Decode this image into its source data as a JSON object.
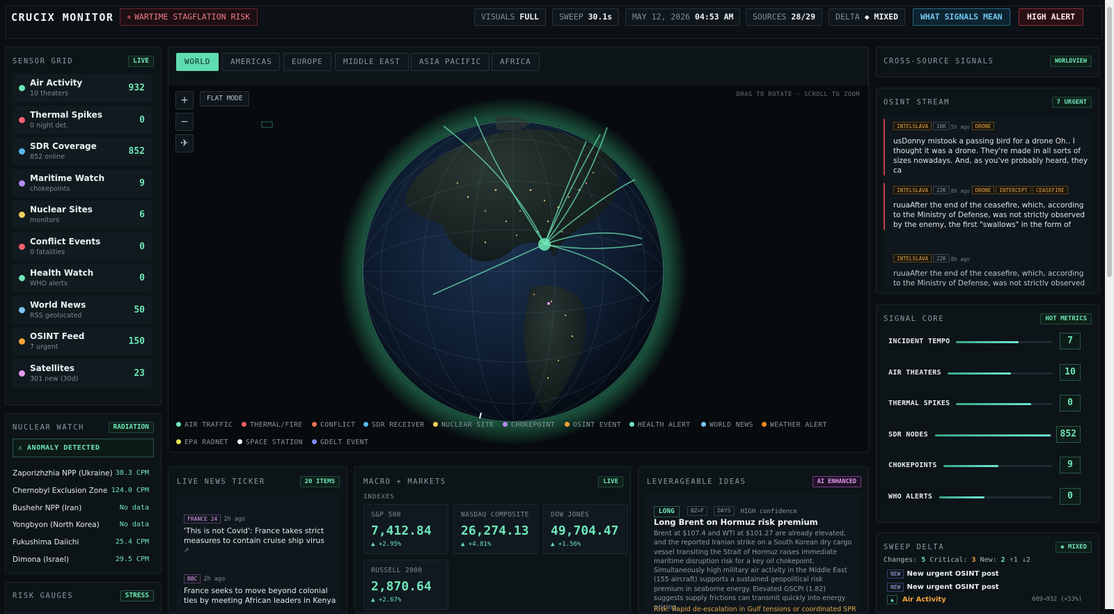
{
  "header": {
    "brand": "CRUCIX MONITOR",
    "risk_label": "WARTIME STAGFLATION RISK",
    "visuals_label": "VISUALS",
    "visuals_value": "FULL",
    "sweep_label": "SWEEP",
    "sweep_value": "30.1s",
    "date_label": "MAY 12, 2026",
    "time_value": "04:53 AM",
    "sources_label": "SOURCES",
    "sources_value": "28/29",
    "delta_label": "DELTA",
    "delta_value": "◆ MIXED",
    "signals_button": "WHAT SIGNALS MEAN",
    "alert_button": "HIGH ALERT"
  },
  "sensor_grid": {
    "title": "SENSOR GRID",
    "badge": "LIVE",
    "items": [
      {
        "name": "Air Activity",
        "sub": "10 theaters",
        "value": "932",
        "color": "#6ee7b7"
      },
      {
        "name": "Thermal Spikes",
        "sub": "0 night det.",
        "value": "0",
        "color": "#f4606a"
      },
      {
        "name": "SDR Coverage",
        "sub": "852 online",
        "value": "852",
        "color": "#5ab8f0"
      },
      {
        "name": "Maritime Watch",
        "sub": "chokepoints",
        "value": "9",
        "color": "#b78af2"
      },
      {
        "name": "Nuclear Sites",
        "sub": "monitors",
        "value": "6",
        "color": "#f2d35a"
      },
      {
        "name": "Conflict Events",
        "sub": "0 fatalities",
        "value": "0",
        "color": "#f4606a"
      },
      {
        "name": "Health Watch",
        "sub": "WHO alerts",
        "value": "0",
        "color": "#6ee7b7"
      },
      {
        "name": "World News",
        "sub": "RSS geolocated",
        "value": "50",
        "color": "#7ec4f2"
      },
      {
        "name": "OSINT Feed",
        "sub": "7 urgent",
        "value": "150",
        "color": "#f6a33a"
      },
      {
        "name": "Satellites",
        "sub": "301 new (30d)",
        "value": "23",
        "color": "#e39af0"
      }
    ]
  },
  "nuclear": {
    "title": "NUCLEAR WATCH",
    "badge": "RADIATION",
    "anomaly": "⚠ ANOMALY DETECTED",
    "rows": [
      {
        "site": "Zaporizhzhia NPP (Ukraine)",
        "value": "38.3 CPM"
      },
      {
        "site": "Chernobyl Exclusion Zone",
        "value": "124.0 CPM"
      },
      {
        "site": "Bushehr NPP (Iran)",
        "value": "No data"
      },
      {
        "site": "Yongbyon (North Korea)",
        "value": "No data"
      },
      {
        "site": "Fukushima Daiichi",
        "value": "25.4 CPM"
      },
      {
        "site": "Dimona (Israel)",
        "value": "29.5 CPM"
      }
    ]
  },
  "risk_gauges": {
    "title": "RISK GAUGES",
    "badge": "STRESS"
  },
  "regions": [
    "WORLD",
    "AMERICAS",
    "EUROPE",
    "MIDDLE EAST",
    "ASIA PACIFIC",
    "AFRICA"
  ],
  "map": {
    "flat_mode": "FLAT MODE",
    "hint": "DRAG TO ROTATE · SCROLL TO ZOOM",
    "zoom_in": "+",
    "zoom_out": "−",
    "plane": "✈",
    "legend": [
      {
        "label": "AIR TRAFFIC",
        "color": "#6ee7b7"
      },
      {
        "label": "THERMAL/FIRE",
        "color": "#f4606a"
      },
      {
        "label": "CONFLICT",
        "color": "#e8734a"
      },
      {
        "label": "SDR RECEIVER",
        "color": "#5ab8f0"
      },
      {
        "label": "NUCLEAR SITE",
        "color": "#f2d35a"
      },
      {
        "label": "CHOKEPOINT",
        "color": "#b78af2"
      },
      {
        "label": "OSINT EVENT",
        "color": "#f6a33a"
      },
      {
        "label": "HEALTH ALERT",
        "color": "#6ee7b7"
      },
      {
        "label": "WORLD NEWS",
        "color": "#7ec4f2"
      },
      {
        "label": "WEATHER ALERT",
        "color": "#f6891f"
      },
      {
        "label": "EPA RADNET",
        "color": "#e3e35a"
      },
      {
        "label": "SPACE STATION",
        "color": "#ffffff"
      },
      {
        "label": "GDELT EVENT",
        "color": "#7f8ef0"
      }
    ]
  },
  "cross_source": {
    "title": "CROSS-SOURCE SIGNALS",
    "badge": "WORLDVIEW"
  },
  "osint": {
    "title": "OSINT STREAM",
    "badge": "7 URGENT",
    "posts": [
      {
        "source": "INTELSLAVA",
        "views": "16K",
        "age": "5h ago",
        "tags": [
          "DRONE"
        ],
        "text": "usDonny mistook a passing bird for a drone Oh.. I thought it was a drone. They're made in all sorts of sizes nowadays. And, as you've probably heard, they ca"
      },
      {
        "source": "INTELSLAVA",
        "views": "22K",
        "age": "8h ago",
        "tags": [
          "DRONE",
          "INTERCEPT",
          "CEASEFIRE"
        ],
        "text": "ruuaAfter the end of the ceasefire, which, according to the Ministry of Defense, was not strictly observed by the enemy, the first \"swallows\" in the form of"
      },
      {
        "source": "INTELSLAVA",
        "views": "22K",
        "age": "8h ago",
        "tags": [],
        "text": "ruuaAfter the end of the ceasefire, which, according to the Ministry of Defense, was not strictly observed by"
      }
    ]
  },
  "signal_core": {
    "title": "SIGNAL CORE",
    "badge": "HOT METRICS",
    "metrics": [
      {
        "label": "INCIDENT TEMPO",
        "value": "7",
        "level": 0.65
      },
      {
        "label": "AIR THEATERS",
        "value": "10",
        "level": 0.6
      },
      {
        "label": "THERMAL SPIKES",
        "value": "0",
        "level": 0.78
      },
      {
        "label": "SDR NODES",
        "value": "852",
        "level": 0.98
      },
      {
        "label": "CHOKEPOINTS",
        "value": "9",
        "level": 0.5
      },
      {
        "label": "WHO ALERTS",
        "value": "0",
        "level": 0.4
      }
    ]
  },
  "sweep_delta": {
    "title": "SWEEP DELTA",
    "badge": "◆ MIXED",
    "changes_label": "Changes:",
    "changes": "5",
    "critical_label": "Critical:",
    "critical": "3",
    "new_label": "New:",
    "new": "2",
    "up": "↑1",
    "down": "↓2",
    "rows": [
      {
        "tag": "NEW",
        "text": "New urgent OSINT post"
      },
      {
        "tag": "NEW",
        "text": "New urgent OSINT post"
      }
    ],
    "air_tag": "▲",
    "air_label": "Air Activity",
    "air_value": "609→932 (+53%)"
  },
  "news_ticker": {
    "title": "LIVE NEWS TICKER",
    "badge": "20 ITEMS",
    "items": [
      {
        "source": "FRANCE 24",
        "age": "2h ago",
        "headline": "'This is not Covid': France takes strict measures to contain cruise ship virus",
        "arrow": "↗"
      },
      {
        "source": "BBC",
        "age": "2h ago",
        "headline": "France seeks to move beyond colonial ties by meeting African leaders in Kenya"
      }
    ]
  },
  "markets": {
    "title": "MACRO + MARKETS",
    "badge": "LIVE",
    "section": "INDEXES",
    "indexes": [
      {
        "label": "S&P 500",
        "value": "7,412.84",
        "change": "▲ +2.95%"
      },
      {
        "label": "NASDAQ COMPOSITE",
        "value": "26,274.13",
        "change": "▲ +4.81%"
      },
      {
        "label": "DOW JONES",
        "value": "49,704.47",
        "change": "▲ +1.56%"
      },
      {
        "label": "RUSSELL 2000",
        "value": "2,870.64",
        "change": "▲ +2.67%"
      }
    ]
  },
  "ideas": {
    "title": "LEVERAGEABLE IDEAS",
    "badge": "AI ENHANCED",
    "direction": "LONG",
    "ticker": "BZ=F",
    "horizon": "DAYS",
    "confidence": "HIGH confidence",
    "headline": "Long Brent on Hormuz risk premium",
    "body": "Brent at $107.4 and WTI at $101.27 are already elevated, and the reported Iranian strike on a South Korean dry cargo vessel transiting the Strait of Hormuz raises immediate maritime disruption risk for a key oil chokepoint. Simultaneously high military air activity in the Middle East (155 aircraft) supports a sustained geopolitical risk premium in seaborne energy. Elevated GSCPI (1.82) suggests supply frictions can transmit quickly into energy pricing.",
    "risk": "Risk: Rapid de-escalation in Gulf tensions or coordinated SPR"
  }
}
